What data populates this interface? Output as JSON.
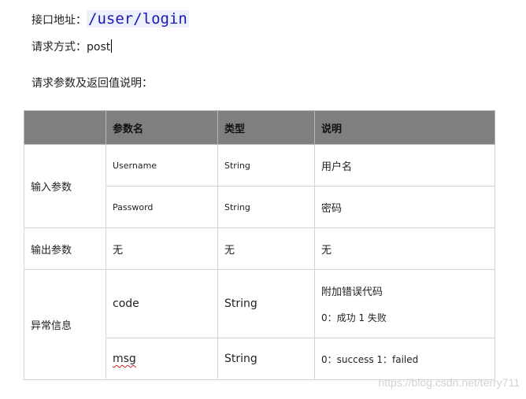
{
  "doc": {
    "url_label": "接口地址：",
    "url_value": "/user/login",
    "method_label": "请求方式：",
    "method_value": "post",
    "params_heading": "请求参数及返回值说明："
  },
  "table": {
    "headers": [
      "",
      "参数名",
      "类型",
      "说明"
    ],
    "input_group": "输入参数",
    "output_group": "输出参数",
    "error_group": "异常信息",
    "rows": {
      "username": {
        "name": "Username",
        "type": "String",
        "desc": "用户名"
      },
      "password": {
        "name": "Password",
        "type": "String",
        "desc": "密码"
      },
      "output": {
        "name": "无",
        "type": "无",
        "desc": "无"
      },
      "code": {
        "name": "code",
        "type": "String",
        "desc_line1": "附加错误代码",
        "desc_line2": "0：成功  1 失败"
      },
      "msg": {
        "name": "msg",
        "type": "String",
        "desc": "0：success   1：failed"
      }
    }
  },
  "watermark": "https://blog.csdn.net/terry711"
}
